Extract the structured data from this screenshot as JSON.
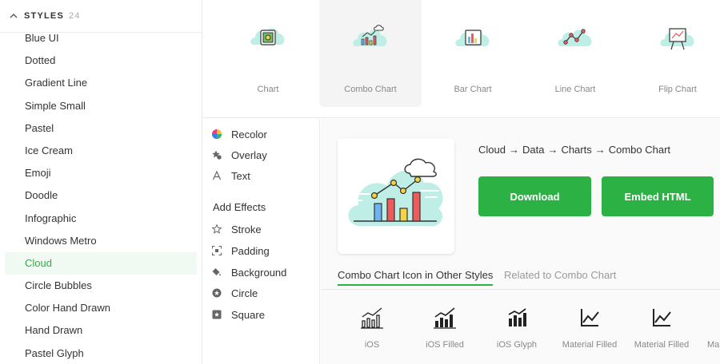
{
  "sidebar": {
    "header": {
      "title": "STYLES",
      "count": "24"
    },
    "items": [
      {
        "label": "Blue UI"
      },
      {
        "label": "Dotted"
      },
      {
        "label": "Gradient Line"
      },
      {
        "label": "Simple Small"
      },
      {
        "label": "Pastel"
      },
      {
        "label": "Ice Cream"
      },
      {
        "label": "Emoji"
      },
      {
        "label": "Doodle"
      },
      {
        "label": "Infographic"
      },
      {
        "label": "Windows Metro"
      },
      {
        "label": "Cloud",
        "active": true
      },
      {
        "label": "Circle Bubbles"
      },
      {
        "label": "Color Hand Drawn"
      },
      {
        "label": "Hand Drawn"
      },
      {
        "label": "Pastel Glyph"
      }
    ]
  },
  "strip": {
    "items": [
      {
        "label": "Chart",
        "icon": "cloud-chart-icon"
      },
      {
        "label": "Combo Chart",
        "icon": "cloud-combo-chart-icon",
        "selected": true
      },
      {
        "label": "Bar Chart",
        "icon": "cloud-bar-chart-icon"
      },
      {
        "label": "Line Chart",
        "icon": "cloud-line-chart-icon"
      },
      {
        "label": "Flip Chart",
        "icon": "cloud-flip-chart-icon"
      }
    ]
  },
  "effects": {
    "recolor": "Recolor",
    "overlay": "Overlay",
    "text": "Text",
    "heading": "Add Effects",
    "stroke": "Stroke",
    "padding": "Padding",
    "background": "Background",
    "circle": "Circle",
    "square": "Square"
  },
  "detail": {
    "breadcrumb": {
      "a": "Cloud",
      "b": "Data",
      "c": "Charts",
      "d": "Combo Chart",
      "sep": "→"
    },
    "download": "Download",
    "embed": "Embed HTML",
    "tabs": {
      "other": "Combo Chart Icon in Other Styles",
      "related": "Related to Combo Chart"
    },
    "other_styles": [
      {
        "label": "iOS",
        "icon": "ios-combo-chart-icon"
      },
      {
        "label": "iOS Filled",
        "icon": "ios-filled-combo-chart-icon"
      },
      {
        "label": "iOS Glyph",
        "icon": "ios-glyph-combo-chart-icon"
      },
      {
        "label": "Material Filled",
        "icon": "material-filled-chart-icon"
      },
      {
        "label": "Material Filled",
        "icon": "material-filled-chart-icon-2"
      },
      {
        "label": "Ma",
        "icon": "material-chart-icon"
      }
    ]
  },
  "colors": {
    "accent": "#2cb145",
    "cloud": "#bfeee6",
    "bar_red": "#ef5b5b",
    "bar_yellow": "#f7d33e",
    "bar_blue": "#6cb4f0"
  }
}
